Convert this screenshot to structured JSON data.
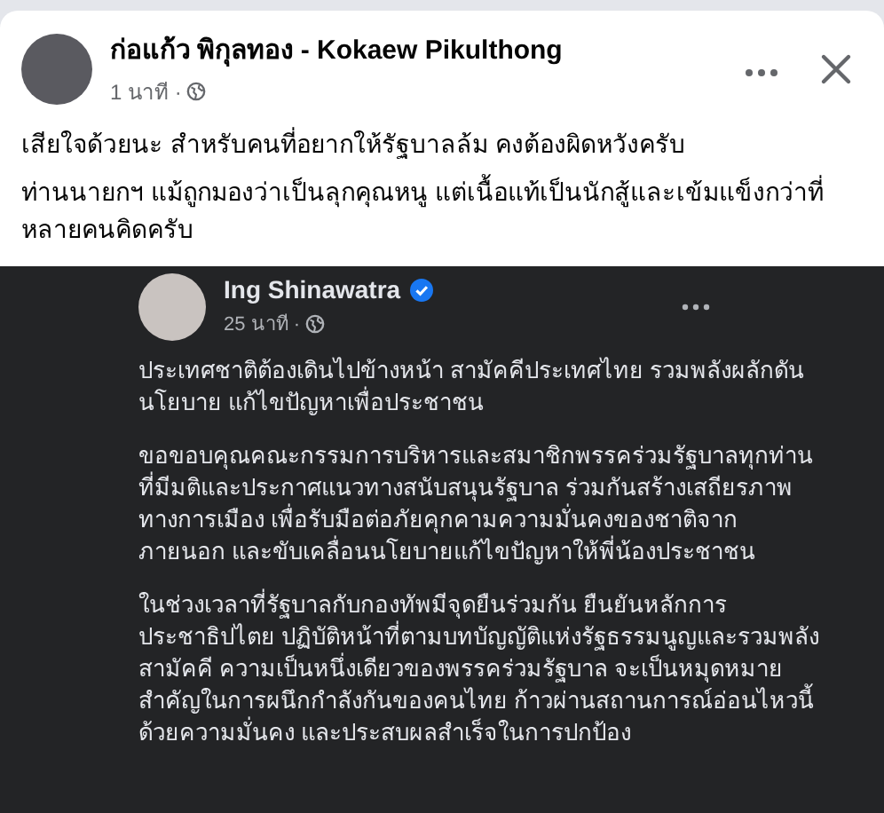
{
  "post": {
    "author": "ก่อแก้ว พิกุลทอง - Kokaew Pikulthong",
    "time": "1 นาที ·",
    "paragraphs": [
      "เสียใจด้วยนะ สำหรับคนที่อยากให้รัฐบาลล้ม คงต้องผิดหวังครับ",
      "ท่านนายกฯ แม้ถูกมองว่าเป็นลุกคุณหนู แต่เนื้อแท้เป็นนักสู้และเข้มแข็งกว่าที่หลายคนคิดครับ"
    ]
  },
  "shared_image": {
    "author": "Ing Shinawatra",
    "verified": true,
    "time": "25 นาที ·",
    "paragraphs": [
      "ประเทศชาติต้องเดินไปข้างหน้า สามัคคีประเทศไทย รวมพลังผลักดันนโยบาย แก้ไขปัญหาเพื่อประชาชน",
      "ขอขอบคุณคณะกรรมการบริหารและสมาชิกพรรคร่วมรัฐบาลทุกท่าน  ที่มีมติและประกาศแนวทางสนับสนุนรัฐบาล ร่วมกันสร้างเสถียรภาพทางการเมือง เพื่อรับมือต่อภัยคุกคามความมั่นคงของชาติจากภายนอก และขับเคลื่อนนโยบายแก้ไขปัญหาให้พี่น้องประชาชน",
      "ในช่วงเวลาที่รัฐบาลกับกองทัพมีจุดยืนร่วมกัน ยืนยันหลักการประชาธิปไตย ปฏิบัติหน้าที่ตามบทบัญญัติแห่งรัฐธรรมนูญและรวมพลังสามัคคี ความเป็นหนึ่งเดียวของพรรคร่วมรัฐบาล จะเป็นหมุดหมายสำคัญในการผนึกกำลังกันของคนไทย ก้าวผ่านสถานการณ์อ่อนไหวนี้ด้วยความมั่นคง และประสบผลสำเร็จในการปกป้อง"
    ]
  }
}
